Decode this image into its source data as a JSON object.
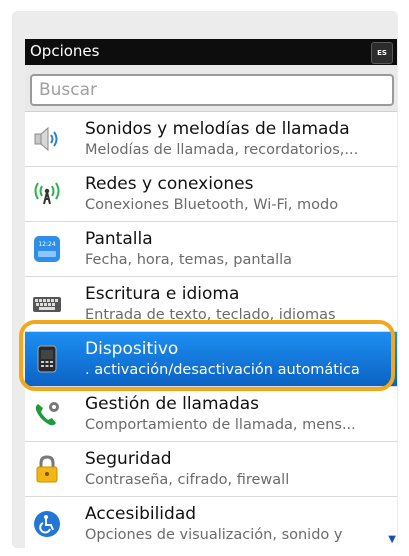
{
  "header": {
    "title": "Opciones",
    "lang_badge": "ES"
  },
  "search": {
    "placeholder": "Buscar"
  },
  "items": [
    {
      "icon": "speaker-icon",
      "title": "Sonidos y melodías de llamada",
      "subtitle": "Melodías de llamada, recordatorios,..."
    },
    {
      "icon": "antenna-icon",
      "title": "Redes y conexiones",
      "subtitle": "Conexiones Bluetooth, Wi-Fi, modo"
    },
    {
      "icon": "display-icon",
      "title": "Pantalla",
      "subtitle": "Fecha, hora, temas, pantalla"
    },
    {
      "icon": "keyboard-icon",
      "title": "Escritura e idioma",
      "subtitle": "Entrada de texto, teclado, idiomas"
    },
    {
      "icon": "device-icon",
      "title": "Dispositivo",
      "subtitle": ". activación/desactivación automática",
      "selected": true
    },
    {
      "icon": "phone-gear-icon",
      "title": "Gestión de llamadas",
      "subtitle": "Comportamiento de llamada, mens..."
    },
    {
      "icon": "padlock-icon",
      "title": "Seguridad",
      "subtitle": "Contraseña, cifrado, firewall"
    },
    {
      "icon": "accessibility-icon",
      "title": "Accesibilidad",
      "subtitle": "Opciones de visualización, sonido y"
    }
  ],
  "colors": {
    "selection": "#0b63c4",
    "highlight_border": "#f2a81d"
  }
}
